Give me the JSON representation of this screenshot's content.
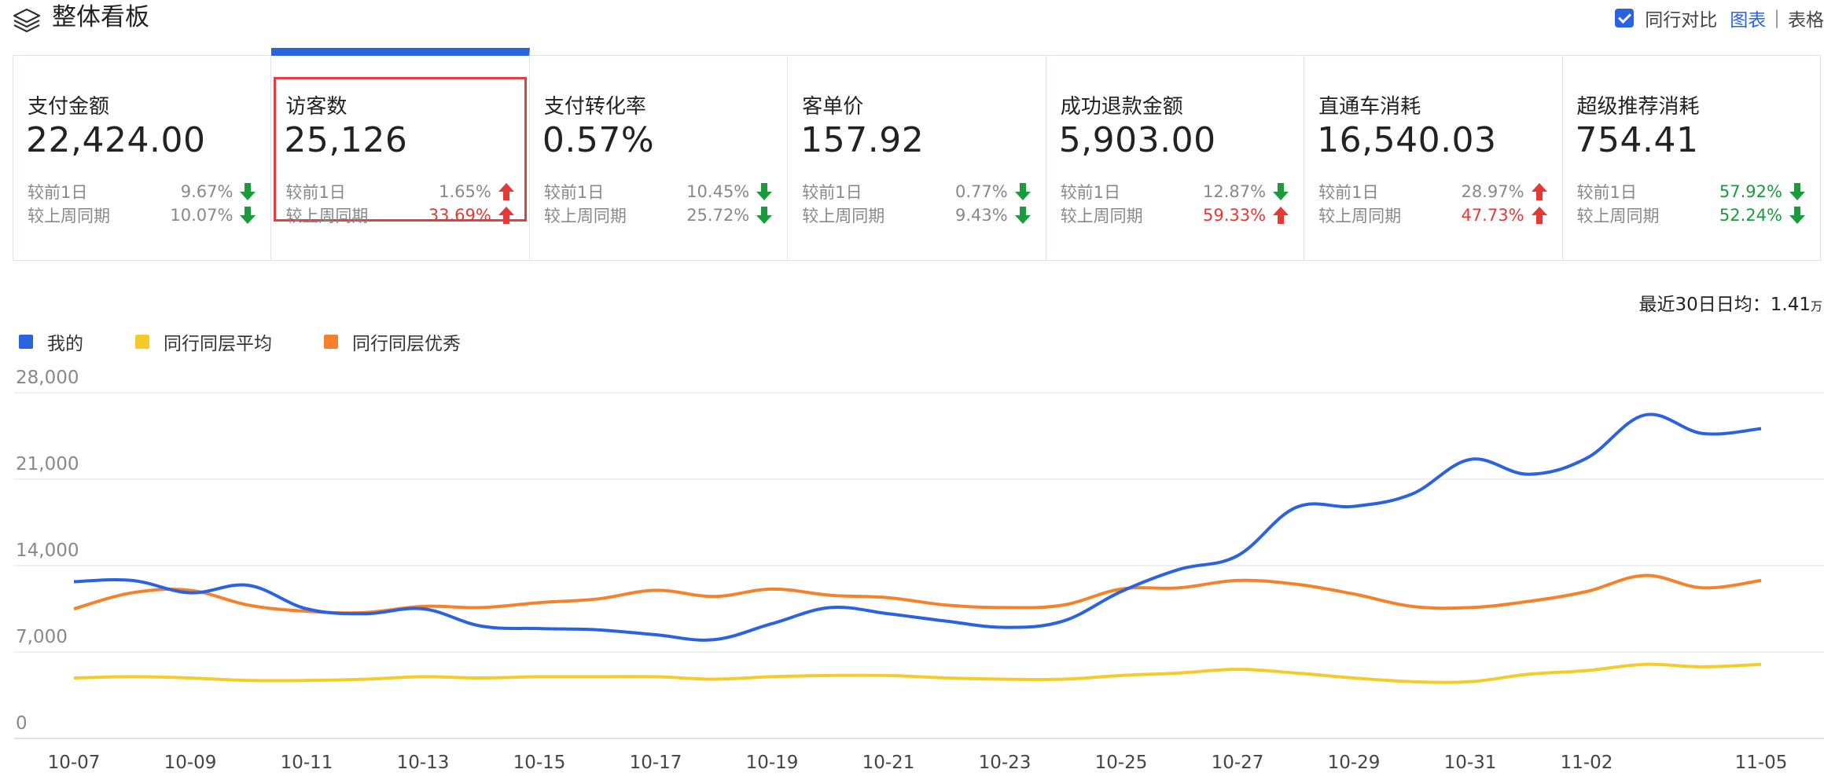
{
  "header": {
    "title": "整体看板",
    "compare_label": "同行对比",
    "view_chart": "图表",
    "view_table": "表格"
  },
  "cards": [
    {
      "label": "支付金额",
      "value": "22,424.00",
      "r1_label": "较前1日",
      "r1_value": "9.67%",
      "r1_dir": "down",
      "r1_color": "gray",
      "r2_label": "较上周同期",
      "r2_value": "10.07%",
      "r2_dir": "down",
      "r2_color": "gray"
    },
    {
      "label": "访客数",
      "value": "25,126",
      "r1_label": "较前1日",
      "r1_value": "1.65%",
      "r1_dir": "up",
      "r1_color": "gray",
      "r2_label": "较上周同期",
      "r2_value": "33.69%",
      "r2_dir": "up",
      "r2_color": "red",
      "selected": true
    },
    {
      "label": "支付转化率",
      "value": "0.57%",
      "r1_label": "较前1日",
      "r1_value": "10.45%",
      "r1_dir": "down",
      "r1_color": "gray",
      "r2_label": "较上周同期",
      "r2_value": "25.72%",
      "r2_dir": "down",
      "r2_color": "gray"
    },
    {
      "label": "客单价",
      "value": "157.92",
      "r1_label": "较前1日",
      "r1_value": "0.77%",
      "r1_dir": "down",
      "r1_color": "gray",
      "r2_label": "较上周同期",
      "r2_value": "9.43%",
      "r2_dir": "down",
      "r2_color": "gray"
    },
    {
      "label": "成功退款金额",
      "value": "5,903.00",
      "r1_label": "较前1日",
      "r1_value": "12.87%",
      "r1_dir": "down",
      "r1_color": "gray",
      "r2_label": "较上周同期",
      "r2_value": "59.33%",
      "r2_dir": "up",
      "r2_color": "red"
    },
    {
      "label": "直通车消耗",
      "value": "16,540.03",
      "r1_label": "较前1日",
      "r1_value": "28.97%",
      "r1_dir": "up",
      "r1_color": "gray",
      "r2_label": "较上周同期",
      "r2_value": "47.73%",
      "r2_dir": "up",
      "r2_color": "red"
    },
    {
      "label": "超级推荐消耗",
      "value": "754.41",
      "r1_label": "较前1日",
      "r1_value": "57.92%",
      "r1_dir": "down",
      "r1_color": "green",
      "r2_label": "较上周同期",
      "r2_value": "52.24%",
      "r2_dir": "down",
      "r2_color": "green"
    }
  ],
  "avg": {
    "label": "最近30日日均：",
    "value": "1.41",
    "unit": "万"
  },
  "colors": {
    "mine": "#2a62e0",
    "peer_avg": "#f5cb2a",
    "peer_top": "#f5822a",
    "up": "#e53935",
    "down": "#1a9b3c"
  },
  "chart_data": {
    "type": "line",
    "x": [
      "10-07",
      "10-08",
      "10-09",
      "10-10",
      "10-11",
      "10-12",
      "10-13",
      "10-14",
      "10-15",
      "10-16",
      "10-17",
      "10-18",
      "10-19",
      "10-20",
      "10-21",
      "10-22",
      "10-23",
      "10-24",
      "10-25",
      "10-26",
      "10-27",
      "10-28",
      "10-29",
      "10-30",
      "10-31",
      "11-01",
      "11-02",
      "11-03",
      "11-04",
      "11-05"
    ],
    "x_tick_labels": [
      "10-07",
      "10-09",
      "10-11",
      "10-13",
      "10-15",
      "10-17",
      "10-19",
      "10-21",
      "10-23",
      "10-25",
      "10-27",
      "10-29",
      "10-31",
      "11-02",
      "11-05"
    ],
    "ylim": [
      0,
      28000
    ],
    "yticks": [
      0,
      7000,
      14000,
      21000,
      28000
    ],
    "ytick_labels": [
      "0",
      "7,000",
      "14,000",
      "21,000",
      "28,000"
    ],
    "grid": true,
    "legend_position": "top-left",
    "series": [
      {
        "name": "我的",
        "color_key": "mine",
        "values": [
          12700,
          12800,
          11800,
          12400,
          10500,
          10100,
          10500,
          9100,
          8900,
          8800,
          8400,
          8000,
          9300,
          10600,
          10100,
          9500,
          9000,
          9500,
          11900,
          13700,
          14800,
          18700,
          18800,
          19800,
          22600,
          21400,
          22700,
          26200,
          24700,
          25100
        ]
      },
      {
        "name": "同行同层平均",
        "color_key": "peer_avg",
        "values": [
          4900,
          5000,
          4900,
          4700,
          4700,
          4800,
          5000,
          4900,
          5000,
          5000,
          5000,
          4800,
          5000,
          5100,
          5100,
          4900,
          4800,
          4800,
          5100,
          5300,
          5600,
          5300,
          4900,
          4600,
          4600,
          5200,
          5500,
          6000,
          5800,
          6000
        ]
      },
      {
        "name": "同行同层优秀",
        "color_key": "peer_top",
        "values": [
          10500,
          11800,
          12000,
          10800,
          10300,
          10200,
          10700,
          10600,
          11000,
          11300,
          12000,
          11500,
          12100,
          11600,
          11400,
          10800,
          10600,
          10800,
          12100,
          12200,
          12800,
          12500,
          11700,
          10700,
          10600,
          11100,
          11900,
          13200,
          12200,
          12800
        ]
      }
    ]
  }
}
